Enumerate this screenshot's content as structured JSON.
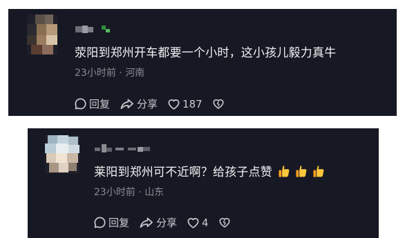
{
  "comments": [
    {
      "text": "荥阳到郑州开车都要一个小时，这小孩儿毅力真牛",
      "time": "23小时前",
      "separator": "·",
      "location": "河南",
      "reply_label": "回复",
      "share_label": "分享",
      "like_count": "187"
    },
    {
      "text": "莱阳到郑州可不近啊？给孩子点赞",
      "emojis": [
        "thumbs-up-icon",
        "thumbs-up-icon",
        "thumbs-up-icon"
      ],
      "time": "23小时前",
      "separator": "·",
      "location": "山东",
      "reply_label": "回复",
      "share_label": "分享",
      "like_count": "4"
    }
  ],
  "colors": {
    "card_background": "#161823",
    "text_primary": "#f2f2f4",
    "text_secondary": "#8a8b91",
    "action_text": "#c9cacd"
  }
}
